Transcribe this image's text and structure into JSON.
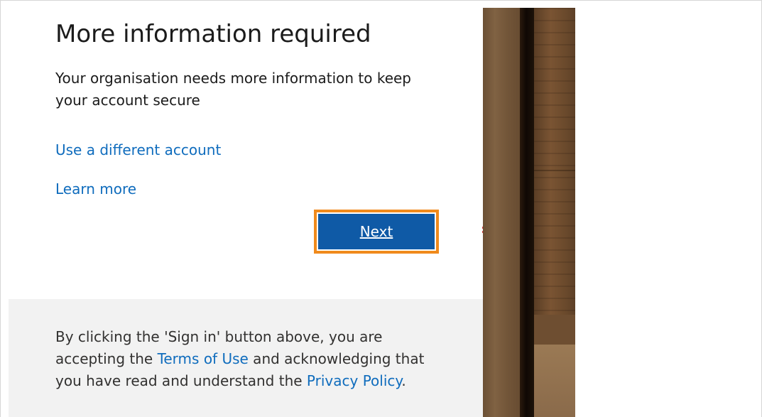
{
  "dialog": {
    "title": "More information required",
    "description": "Your organisation needs more information to keep your account secure",
    "links": {
      "different_account": "Use a different account",
      "learn_more": "Learn more"
    },
    "next_button": "Next",
    "footer": {
      "text_1": "By clicking the 'Sign in' button above, you are accepting the ",
      "terms_link": "Terms of Use",
      "text_2": " and acknowledging that you have read and understand the ",
      "privacy_link": "Privacy Policy",
      "text_3": "."
    }
  },
  "colors": {
    "link": "#0f6cbd",
    "button": "#0f5aa6",
    "highlight_outline": "#f08a1c",
    "footer_bg": "#f2f2f2"
  }
}
